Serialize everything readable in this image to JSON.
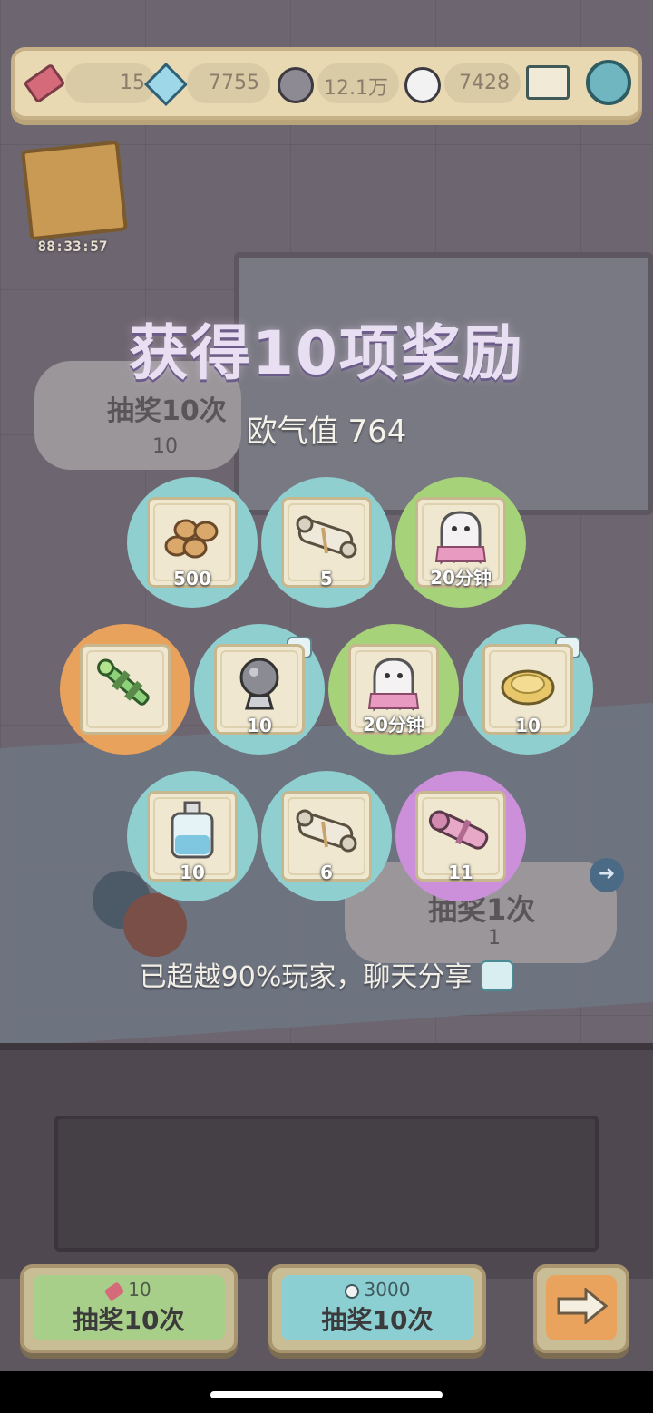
{
  "currencies": {
    "tickets": "15",
    "crystals": "7755",
    "gray_bubbles": "12.1万",
    "white_bubbles": "7428"
  },
  "event": {
    "timer": "88:33:57"
  },
  "background_buttons": {
    "draw10_label": "抽奖10次",
    "draw10_cost": "10",
    "draw1_label": "抽奖1次",
    "draw1_cost": "1"
  },
  "result": {
    "title": "获得10项奖励",
    "luck_label": "欧气值",
    "luck_value": "764",
    "share_text": "已超越90%玩家，聊天分享"
  },
  "rewards": [
    {
      "item": "wood-logs",
      "amount": "500",
      "bg": "#8fcfcf"
    },
    {
      "item": "scroll",
      "amount": "5",
      "bg": "#8fcfcf"
    },
    {
      "item": "ghost-time",
      "amount": "20分钟",
      "bg": "#a6d27a"
    },
    {
      "item": "green-staff",
      "amount": "",
      "bg": "#e9a25c"
    },
    {
      "item": "crystal-ball",
      "amount": "10",
      "bg": "#8fcfcf"
    },
    {
      "item": "ghost-time",
      "amount": "20分钟",
      "bg": "#a6d27a"
    },
    {
      "item": "golden-plate",
      "amount": "10",
      "bg": "#8fcfcf"
    },
    {
      "item": "potion-bottle",
      "amount": "10",
      "bg": "#8fcfcf"
    },
    {
      "item": "scroll",
      "amount": "6",
      "bg": "#8fcfcf"
    },
    {
      "item": "pink-cannon",
      "amount": "11",
      "bg": "#cc8fd9"
    }
  ],
  "bottom_buttons": {
    "ticket_draw": {
      "cost": "10",
      "label": "抽奖10次"
    },
    "bubble_draw": {
      "cost": "3000",
      "label": "抽奖10次"
    }
  }
}
